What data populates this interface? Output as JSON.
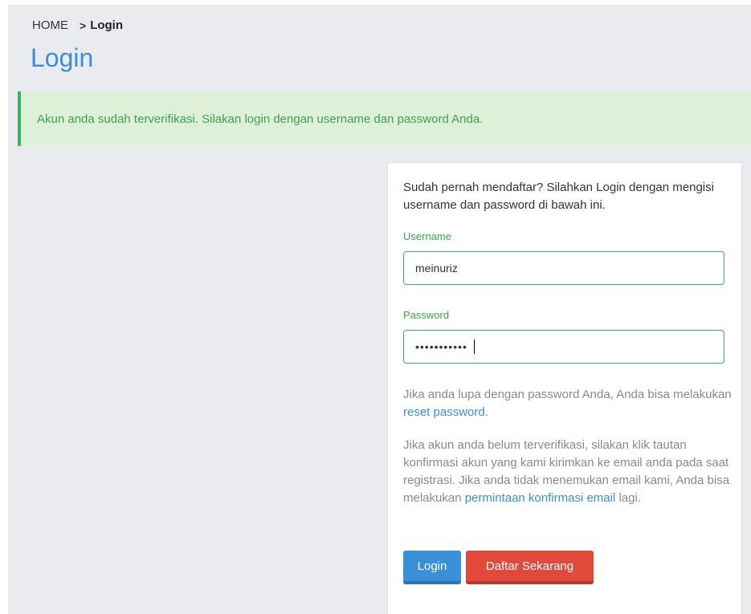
{
  "breadcrumb": {
    "home": "HOME",
    "separator": ">",
    "current": "Login"
  },
  "page": {
    "title": "Login"
  },
  "alert": {
    "message": "Akun anda sudah terverifikasi. Silakan login dengan username dan password Anda."
  },
  "form": {
    "intro": "Sudah pernah mendaftar? Silahkan Login dengan mengisi username dan password di bawah ini.",
    "username_label": "Username",
    "username_value": "meinuriz",
    "password_label": "Password",
    "password_value": "meinuriz123",
    "forgot_text": "Jika anda lupa dengan password Anda, Anda bisa melakukan",
    "forgot_link": "reset password",
    "forgot_end": ".",
    "verify_text": "Jika akun anda belum terverifikasi, silakan klik tautan konfirmasi akun yang kami kirimkan ke email anda pada saat registrasi. Jika anda tidak menemukan email kami, Anda bisa melakukan",
    "verify_link": "permintaan konfirmasi email",
    "verify_end": "lagi.",
    "login_button": "Login",
    "register_button": "Daftar Sekarang"
  },
  "colors": {
    "accent": "#3a8fd9",
    "success": "#3cb064",
    "danger": "#e14a3b",
    "background": "#e9ebee"
  }
}
